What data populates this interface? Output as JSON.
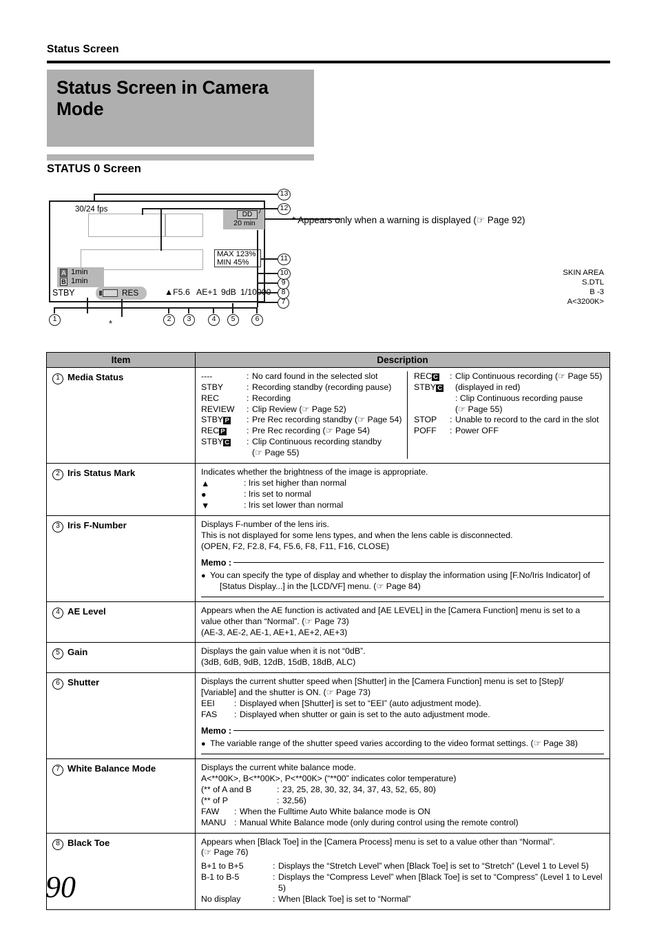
{
  "page": {
    "running_head": "Status Screen",
    "title": "Status Screen in Camera Mode",
    "section_title": "STATUS 0 Screen",
    "page_number": "90"
  },
  "figure": {
    "fps_label": "30/24 fps",
    "dd_chip": "DD",
    "dd_minutes": "20 min",
    "max_label": "MAX 123%",
    "min_label": "MIN    45%",
    "skin_area": "SKIN AREA",
    "s_dtl": "S.DTL",
    "black_toe": "B -3",
    "white_balance": "A<3200K>",
    "slot_a_icon": "A",
    "slot_a_time": "1min",
    "slot_b_icon": "B",
    "slot_b_time": "1min",
    "media_status": "STBY",
    "res_label": "RES",
    "iris_mark": "▲F5.6",
    "ae_level": "AE+1",
    "gain": "9dB",
    "shutter": "1/10000",
    "callouts": [
      "1",
      "2",
      "3",
      "4",
      "5",
      "6",
      "7",
      "8",
      "9",
      "10",
      "11",
      "12",
      "13"
    ],
    "asterisk": "*",
    "warning_note": "* Appears only when a warning is displayed (☞  Page 92)"
  },
  "table": {
    "headers": {
      "item": "Item",
      "description": "Description"
    },
    "rows": [
      {
        "num": "1",
        "name": "Media Status",
        "left": [
          {
            "k": "----",
            "v": "No card found in the selected slot"
          },
          {
            "k": "STBY",
            "v": "Recording standby (recording pause)"
          },
          {
            "k": "REC",
            "v": "Recording"
          },
          {
            "k": "REVIEW",
            "v": "Clip Review (☞ Page 52)"
          },
          {
            "k": "STBY",
            "tag": "P",
            "v": "Pre Rec recording standby (☞  Page 54)"
          },
          {
            "k": "REC",
            "tag": "P",
            "v": "Pre Rec recording (☞ Page 54)"
          },
          {
            "k": "STBY",
            "tag": "C",
            "v": "Clip Continuous recording standby"
          },
          {
            "k": "",
            "v": "(☞  Page 55)",
            "cont": true
          }
        ],
        "right": [
          {
            "k": "REC",
            "tag": "C",
            "v": "Clip Continuous recording (☞  Page 55)"
          },
          {
            "k": "STBY",
            "tag": "C",
            "v": "(displayed in red)",
            "nocolon": true
          },
          {
            "k": "",
            "v": ": Clip Continuous recording pause",
            "raw": true
          },
          {
            "k": "",
            "v": "   (☞  Page 55)",
            "raw": true
          },
          {
            "k": "STOP",
            "v": "Unable to record to the card in the slot"
          },
          {
            "k": "POFF",
            "v": "Power OFF"
          }
        ]
      },
      {
        "num": "2",
        "name": "Iris Status Mark",
        "lines": [
          "Indicates whether the brightness of the image is appropriate."
        ],
        "marks": [
          {
            "m": "▲",
            "v": ": Iris set higher than normal"
          },
          {
            "m": "●",
            "v": ": Iris set to normal"
          },
          {
            "m": "▼",
            "v": ": Iris set lower than normal"
          }
        ]
      },
      {
        "num": "3",
        "name": "Iris F-Number",
        "lines": [
          "Displays F-number of the lens iris.",
          "This is not displayed for some lens types, and when the lens cable is disconnected.",
          "(OPEN, F2, F2.8, F4, F5.6, F8, F11, F16, CLOSE)"
        ],
        "memo": {
          "title": "Memo :",
          "bullet": "You can specify the type of display and whether to display the information using [F.No/Iris Indicator] of",
          "bullet_cont": "[Status Display...] in the [LCD/VF] menu. (☞  Page 84)"
        }
      },
      {
        "num": "4",
        "name": "AE Level",
        "lines": [
          "Appears when the AE function is activated and [AE LEVEL] in the [Camera Function] menu is set to a",
          "value other than “Normal”. (☞  Page 73)",
          "(AE-3, AE-2, AE-1, AE+1, AE+2, AE+3)"
        ]
      },
      {
        "num": "5",
        "name": "Gain",
        "lines": [
          "Displays the gain value when it is not “0dB”.",
          "(3dB, 6dB, 9dB, 12dB, 15dB, 18dB, ALC)"
        ]
      },
      {
        "num": "6",
        "name": "Shutter",
        "lines": [
          "Displays the current shutter speed when [Shutter] in the [Camera Function] menu is set to [Step]/",
          "[Variable] and the shutter is ON. (☞  Page 73)"
        ],
        "kvs": [
          {
            "k": "EEI",
            "v": "Displayed when [Shutter] is set to “EEI” (auto adjustment mode)."
          },
          {
            "k": "FAS",
            "v": "Displayed when shutter or gain is set to the auto adjustment mode."
          }
        ],
        "memo": {
          "title": "Memo :",
          "bullet": "The variable range of the shutter speed varies according to the video format settings. (☞  Page 38)"
        }
      },
      {
        "num": "7",
        "name": "White Balance Mode",
        "lines": [
          "Displays the current white balance mode.",
          "A<**00K>, B<**00K>, P<**00K> (“**00” indicates color temperature)"
        ],
        "kvs": [
          {
            "k": "(** of A and B",
            "v": "23, 25, 28, 30, 32, 34, 37, 43, 52, 65, 80)",
            "wide": true
          },
          {
            "k": "(** of P",
            "v": "32,56)",
            "wide": true
          },
          {
            "k": "FAW",
            "v": "When the Fulltime Auto White balance mode is ON"
          },
          {
            "k": "MANU",
            "v": "Manual White Balance mode (only during control using the remote control)"
          }
        ]
      },
      {
        "num": "8",
        "name": "Black Toe",
        "lines": [
          "Appears when [Black Toe] in the [Camera Process] menu is set to a value other than “Normal”.",
          "(☞  Page 76)"
        ],
        "kvs": [
          {
            "k": "B+1 to B+5",
            "v": "Displays the “Stretch Level” when [Black Toe] is set to “Stretch” (Level 1 to Level 5)",
            "wide2": true
          },
          {
            "k": "B-1 to B-5",
            "v": "Displays the “Compress Level” when [Black Toe] is set to “Compress” (Level 1 to Level 5)",
            "wide2": true
          },
          {
            "k": "No display",
            "v": "When [Black Toe] is set to “Normal”",
            "wide2": true
          }
        ]
      }
    ]
  },
  "colors": {
    "band_gray": "#afafaf",
    "header_gray": "#b3b3b3",
    "screen_shade": "#b8b8b8"
  }
}
